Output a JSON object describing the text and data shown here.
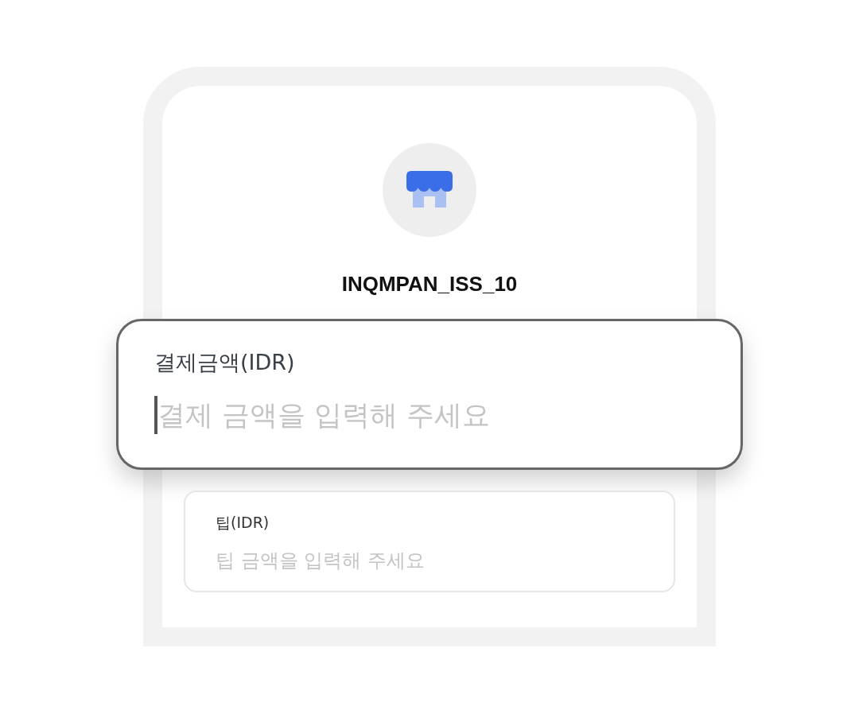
{
  "merchant": {
    "name": "INQMPAN_ISS_10"
  },
  "fields": [
    {
      "label": "결제금액(IDR)",
      "placeholder": "결제 금액을 입력해 주세요",
      "focused": true
    },
    {
      "label": "팁(IDR)",
      "placeholder": "팁 금액을 입력해 주세요",
      "focused": false
    }
  ]
}
